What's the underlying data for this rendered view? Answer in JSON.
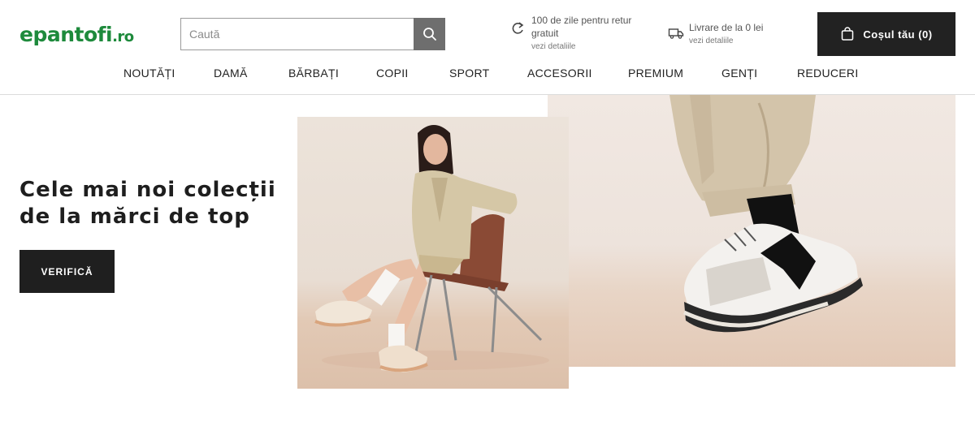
{
  "header": {
    "logo": {
      "brand": "epantofi",
      "tld": ".ro"
    },
    "search": {
      "placeholder": "Caută",
      "icon": "search-icon"
    },
    "return_info": {
      "main": "100 de zile pentru retur gratuit",
      "sub": "vezi detaliile",
      "icon": "return-arrow-icon"
    },
    "delivery_info": {
      "main": "Livrare de la 0 lei",
      "sub": "vezi detaliile",
      "icon": "truck-icon"
    },
    "cart": {
      "label": "Coșul tău (0)",
      "icon": "shopping-bag-icon"
    }
  },
  "nav": {
    "items": [
      {
        "label": "NOUTĂȚI"
      },
      {
        "label": "DAMĂ"
      },
      {
        "label": "BĂRBAȚI"
      },
      {
        "label": "COPII"
      },
      {
        "label": "SPORT"
      },
      {
        "label": "ACCESORII"
      },
      {
        "label": "PREMIUM"
      },
      {
        "label": "GENȚI"
      },
      {
        "label": "REDUCERI"
      }
    ]
  },
  "hero": {
    "title_line1": "Cele mai noi colecții",
    "title_line2": "de la mărci de top",
    "button": "VERIFICĂ"
  },
  "colors": {
    "brand_green": "#1e8a3c",
    "dark": "#222222",
    "search_button": "#6e6e6e"
  }
}
